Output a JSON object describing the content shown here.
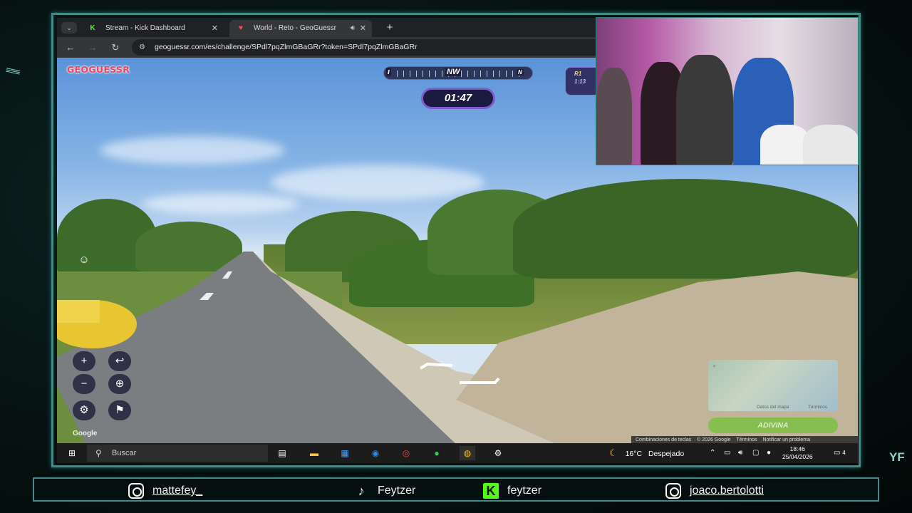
{
  "browser": {
    "tabs": [
      {
        "label": "Stream - Kick Dashboard",
        "active": false
      },
      {
        "label": "World - Reto - GeoGuessr",
        "active": true
      }
    ],
    "url": "geoguessr.com/es/challenge/SPdl7pqZlmGBaGRr?token=SPdl7pqZlmGBaGRr"
  },
  "game": {
    "logo": "GEOGUESSR",
    "compass": {
      "nw": "NW",
      "n": "N"
    },
    "timer": "01:47",
    "round": {
      "label": "R1",
      "time": "1:13"
    },
    "google_watermark": "Google",
    "minimap_labels": {
      "data": "Datos del mapa",
      "terms": "Términos"
    },
    "guess_button": "ADIVINA",
    "map_footer": [
      "Combinaciones de teclas",
      "© 2026 Google",
      "Términos",
      "Notificar un problema"
    ]
  },
  "taskbar": {
    "search_placeholder": "Buscar",
    "weather_temp": "16°C",
    "weather_desc": "Despejado",
    "time": "18:46",
    "date": "25/04/2026",
    "notifications": "4"
  },
  "socials": [
    {
      "icon": "instagram-icon",
      "handle": "mattefey_"
    },
    {
      "icon": "tiktok-icon",
      "handle": "Feytzer"
    },
    {
      "icon": "kick-icon",
      "handle": "feytzer"
    },
    {
      "icon": "instagram-icon",
      "handle": "joaco.bertolotti"
    }
  ],
  "colors": {
    "accent_frame": "#3f8c86",
    "kick_green": "#53fc18",
    "geoguessr_red": "#ff3e58",
    "timer_purple": "#7e5ccc"
  }
}
